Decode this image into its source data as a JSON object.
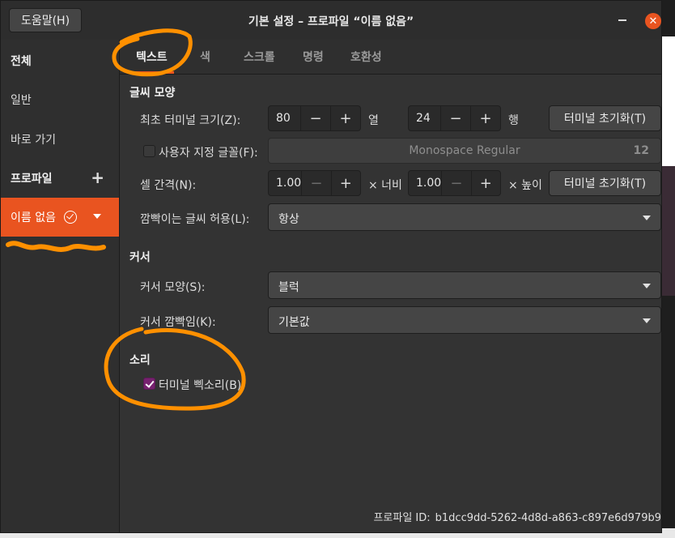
{
  "header": {
    "help_label": "도움말(H)",
    "title": "기본 설정 – 프로파일 “이름 없음”"
  },
  "sidebar": {
    "items": [
      {
        "label": "전체"
      },
      {
        "label": "일반"
      },
      {
        "label": "바로 가기"
      },
      {
        "label": "프로파일",
        "add_symbol": "+"
      },
      {
        "label": "이름 없음"
      }
    ]
  },
  "tabs": [
    "텍스트",
    "색",
    "스크롤",
    "명령",
    "호환성"
  ],
  "text_section": {
    "title": "글씨 모양",
    "initial_size_label": "최초 터미널 크기(Z):",
    "columns_value": "80",
    "columns_unit": "열",
    "rows_value": "24",
    "rows_unit": "행",
    "reset_label": "터미널 초기화(T)",
    "custom_font_label": "사용자 지정 글꼴(F):",
    "custom_font_checked": false,
    "font_name": "Monospace Regular",
    "font_size": "12",
    "spacing_label": "셀 간격(N):",
    "width_value": "1.00",
    "width_unit": "× 너비",
    "height_value": "1.00",
    "height_unit": "× 높이",
    "reset_label_2": "터미널 초기화(T)",
    "blink_label": "깜빡이는 글씨 허용(L):",
    "blink_value": "항상"
  },
  "cursor_section": {
    "title": "커서",
    "shape_label": "커서 모양(S):",
    "shape_value": "블럭",
    "blink_label": "커서 깜빡임(K):",
    "blink_value": "기본값"
  },
  "sound_section": {
    "title": "소리",
    "bell_label": "터미널 삑소리(B)",
    "bell_checked": true
  },
  "footer": {
    "profile_id_label": "프로파일 ID:",
    "profile_id_value": "b1dcc9dd-5262-4d8d-a863-c897e6d979b9"
  },
  "colors": {
    "accent": "#e95420",
    "checkbox": "#77216f",
    "annotation": "#ff9000"
  },
  "icons": {
    "minimize": "minimize-icon",
    "close": "close-icon",
    "add": "plus-icon",
    "default_profile": "check-circle-icon",
    "profile_menu": "caret-down-icon",
    "combo": "caret-down-icon",
    "spin_minus": "minus-icon",
    "spin_plus": "plus-icon"
  }
}
